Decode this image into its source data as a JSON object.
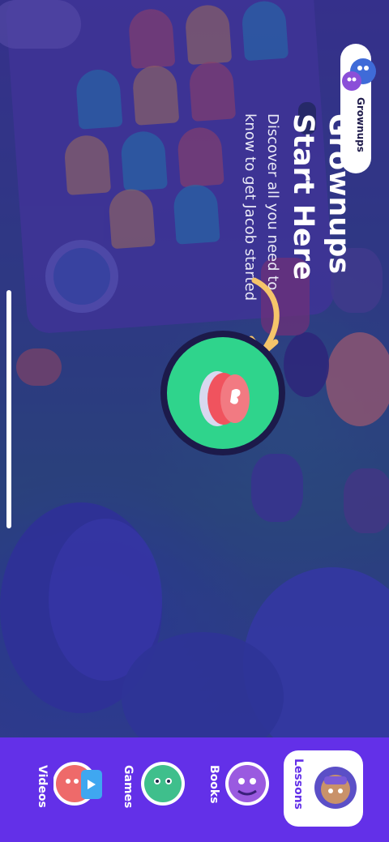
{
  "welcome": {
    "title_line1": "Grownups",
    "title_line2": "Start Here",
    "subtitle_line1": "Discover all you need to",
    "subtitle_line2": "know to get Jacob started"
  },
  "grownups_button": {
    "label": "Grownups"
  },
  "start_button": {
    "icon": "hand-press-icon"
  },
  "nav": {
    "selected": "Lessons",
    "items": [
      {
        "label": "Lessons",
        "icon": "lessons-character-icon"
      },
      {
        "label": "Books",
        "icon": "books-character-icon"
      },
      {
        "label": "Games",
        "icon": "games-character-icon"
      },
      {
        "label": "Videos",
        "icon": "videos-character-icon"
      }
    ]
  },
  "colors": {
    "navbar": "#6330e8",
    "start_button": "#2fd48c",
    "start_button_center": "#f0535e",
    "arrow": "#f5c46a"
  }
}
